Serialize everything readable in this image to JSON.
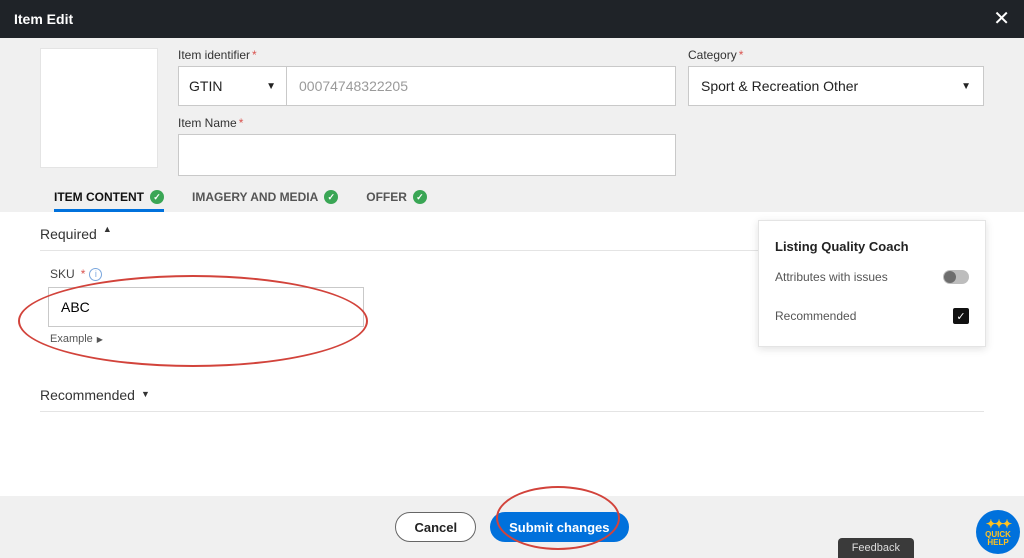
{
  "header": {
    "title": "Item Edit"
  },
  "labels": {
    "item_identifier": "Item identifier",
    "category": "Category",
    "item_name": "Item Name"
  },
  "identifier": {
    "type_selected": "GTIN",
    "value_placeholder": "00074748322205"
  },
  "category": {
    "selected": "Sport & Recreation Other"
  },
  "item_name_value": "",
  "tabs": {
    "item_content": "ITEM CONTENT",
    "imagery": "IMAGERY AND MEDIA",
    "offer": "OFFER"
  },
  "sections": {
    "required": "Required",
    "recommended": "Recommended"
  },
  "sku": {
    "label": "SKU",
    "value": "ABC",
    "example_label": "Example"
  },
  "coach": {
    "title": "Listing Quality Coach",
    "attributes_issues": "Attributes with issues",
    "recommended": "Recommended"
  },
  "footer": {
    "cancel": "Cancel",
    "submit": "Submit changes"
  },
  "misc": {
    "feedback": "Feedback",
    "quick": "QUICK",
    "help": "HELP"
  }
}
